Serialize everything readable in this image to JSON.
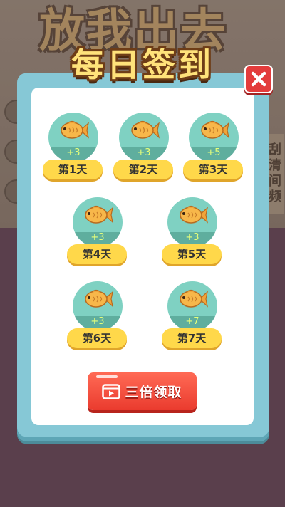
{
  "background": {
    "title": "放我出去",
    "side_button": "刮清间频"
  },
  "dialog": {
    "title": "每日签到",
    "close_icon": "close-icon",
    "days": [
      {
        "label": "第1天",
        "amount": "+3",
        "icon": "fish-icon"
      },
      {
        "label": "第2天",
        "amount": "+3",
        "icon": "fish-icon"
      },
      {
        "label": "第3天",
        "amount": "+5",
        "icon": "fish-icon"
      },
      {
        "label": "第4天",
        "amount": "+3",
        "icon": "fish-icon"
      },
      {
        "label": "第5天",
        "amount": "+3",
        "icon": "fish-icon"
      },
      {
        "label": "第6天",
        "amount": "+3",
        "icon": "fish-icon"
      },
      {
        "label": "第7天",
        "amount": "+7",
        "icon": "fish-icon"
      }
    ],
    "claim_button": {
      "label": "三倍领取",
      "icon": "video-icon"
    },
    "colors": {
      "frame": "#86c8d6",
      "coin_circle": "#7fd1c2",
      "day_label": "#ffd84a",
      "claim_button": "#ea3b2e",
      "close_button": "#e33c3c"
    }
  }
}
